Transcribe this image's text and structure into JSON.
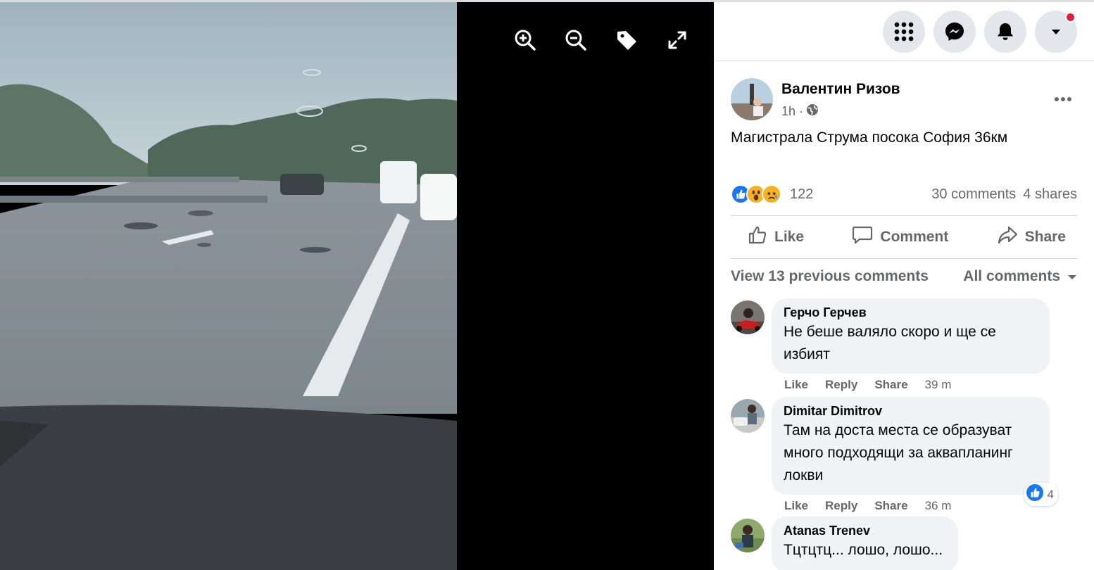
{
  "viewer": {
    "tools": [
      {
        "name": "zoom-in-icon"
      },
      {
        "name": "zoom-out-icon"
      },
      {
        "name": "tag-icon"
      },
      {
        "name": "fullscreen-icon"
      }
    ]
  },
  "topbar": {
    "buttons": [
      "menu-grid-icon",
      "messenger-icon",
      "notifications-bell-icon",
      "account-dropdown-icon"
    ],
    "notification_color": "#e41e3f"
  },
  "post": {
    "author": "Валентин Ризов",
    "time": "1h ·",
    "text": "Магистрала Струма посока София 36км",
    "reaction_count": "122",
    "comments_count": "30 comments",
    "shares_count": "4 shares",
    "actions": {
      "like": "Like",
      "comment": "Comment",
      "share": "Share"
    }
  },
  "comments_bar": {
    "view_previous": "View 13 previous comments",
    "filter": "All comments"
  },
  "comments": [
    {
      "name": "Герчо Герчев",
      "lines": [
        "Не беше валяло скоро и ще се",
        "избият"
      ],
      "like": "Like",
      "reply": "Reply",
      "share": "Share",
      "time": "39 m"
    },
    {
      "name": "Dimitar Dimitrov",
      "lines": [
        "Там на доста места се образуват",
        "много подходящи за аквапланинг",
        "локви"
      ],
      "like": "Like",
      "reply": "Reply",
      "share": "Share",
      "time": "36 m",
      "reactions": "4"
    },
    {
      "name": "Atanas Trenev",
      "lines": [
        "Тцтцтц... лошо, лошо..."
      ]
    }
  ],
  "colors": {
    "accent": "#1877f2",
    "muted": "#65676b",
    "bubble": "#f0f2f5"
  }
}
